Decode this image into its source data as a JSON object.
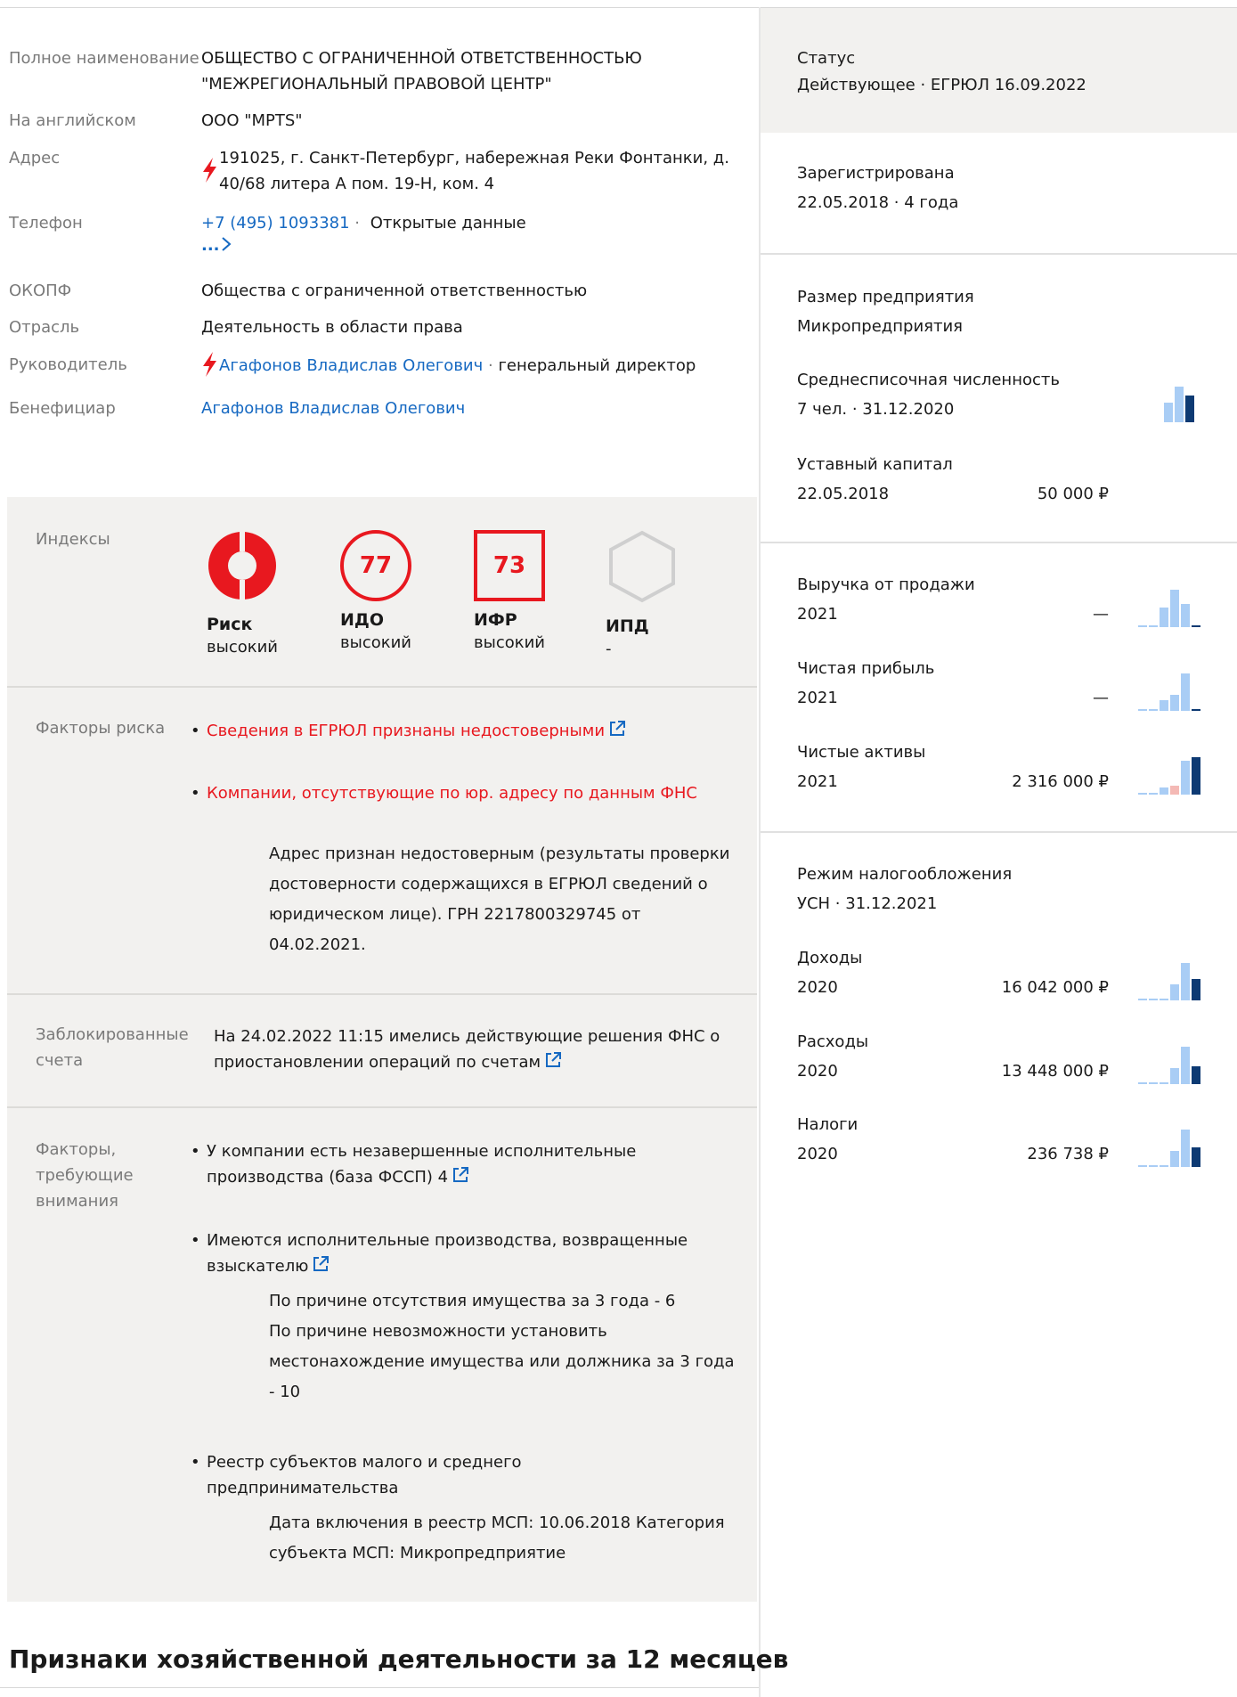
{
  "info": {
    "full_name_label": "Полное наименование",
    "full_name_value": "ОБЩЕСТВО С ОГРАНИЧЕННОЙ ОТВЕТСТВЕННОСТЬЮ \"МЕЖРЕГИОНАЛЬНЫЙ ПРАВОВОЙ ЦЕНТР\"",
    "english_label": "На английском",
    "english_value": "ООО \"MPTS\"",
    "address_label": "Адрес",
    "address_value": "191025, г. Санкт-Петербург, набережная Реки Фонтанки, д. 40/68 литера А пом. 19-Н, ком. 4",
    "phone_label": "Телефон",
    "phone_value": "+7 (495) 1093381",
    "phone_sep": "·",
    "phone_source": "Открытые данные",
    "phone_more": "...",
    "okopf_label": "ОКОПФ",
    "okopf_value": "Общества с ограниченной ответственностью",
    "industry_label": "Отрасль",
    "industry_value": "Деятельность в области права",
    "head_label": "Руководитель",
    "head_name": "Агафонов Владислав Олегович",
    "head_sep": "·",
    "head_role": "генеральный директор",
    "beneficiary_label": "Бенефициар",
    "beneficiary_value": "Агафонов Владислав Олегович"
  },
  "indexes": {
    "label": "Индексы",
    "items": [
      {
        "name": "Риск",
        "value": "высокий",
        "badge": ""
      },
      {
        "name": "ИДО",
        "value": "высокий",
        "badge": "77"
      },
      {
        "name": "ИФР",
        "value": "высокий",
        "badge": "73"
      },
      {
        "name": "ИПД",
        "value": "-",
        "badge": ""
      }
    ]
  },
  "risk_factors": {
    "label": "Факторы риска",
    "items": [
      {
        "text": "Сведения в ЕГРЮЛ признаны недостоверными"
      },
      {
        "text": "Компании, отсутствующие по юр. адресу по данным ФНС",
        "detail": "Адрес признан недостоверным (результаты проверки достоверности содержащихся в ЕГРЮЛ сведений о юридическом лице). ГРН 2217800329745 от 04.02.2021."
      }
    ]
  },
  "blocked": {
    "label": "Заблокированные счета",
    "text": "На 24.02.2022 11:15 имелись действующие решения ФНС о приостановлении операций по счетам"
  },
  "attention": {
    "label": "Факторы, требующие внимания",
    "items": [
      {
        "text": "У компании есть незавершенные исполнительные производства (база ФССП) 4"
      },
      {
        "text": "Имеются исполнительные производства, возвращенные взыскателю",
        "details": [
          "По причине отсутствия имущества за 3 года - 6",
          "По причине невозможности установить местонахождение имущества или должника за 3 года - 10"
        ]
      },
      {
        "text": "Реестр субъектов малого и среднего предпринимательства",
        "detail": "Дата включения в реестр МСП: 10.06.2018 Категория субъекта МСП: Микропредприятие"
      }
    ]
  },
  "section_title": "Признаки хозяйственной деятельности за 12 месяцев",
  "right": {
    "status_label": "Статус",
    "status_value": "Действующее · ЕГРЮЛ 16.09.2022",
    "registered_label": "Зарегистрирована",
    "registered_value": "22.05.2018 · 4 года",
    "size_label": "Размер предприятия",
    "size_value": "Микропредприятия",
    "headcount_label": "Среднесписочная численность",
    "headcount_value": "7 чел. · 31.12.2020",
    "capital_label": "Уставный капитал",
    "capital_date": "22.05.2018",
    "capital_value": "50 000 ₽",
    "revenue_label": "Выручка от продажи",
    "revenue_year": "2021",
    "revenue_value": "—",
    "profit_label": "Чистая прибыль",
    "profit_year": "2021",
    "profit_value": "—",
    "assets_label": "Чистые активы",
    "assets_year": "2021",
    "assets_value": "2 316 000 ₽",
    "tax_regime_label": "Режим налогообложения",
    "tax_regime_value": "УСН · 31.12.2021",
    "income_label": "Доходы",
    "income_year": "2020",
    "income_value": "16 042 000 ₽",
    "expenses_label": "Расходы",
    "expenses_year": "2020",
    "expenses_value": "13 448 000 ₽",
    "taxes_label": "Налоги",
    "taxes_year": "2020",
    "taxes_value": "236 738 ₽"
  },
  "colors": {
    "accent_red": "#e8181f",
    "link_blue": "#1669c2",
    "bar_light": "#a9cdf5",
    "bar_dark": "#0d3a73",
    "bar_pink": "#f4b9b5",
    "panel_gray": "#f2f1ef"
  }
}
